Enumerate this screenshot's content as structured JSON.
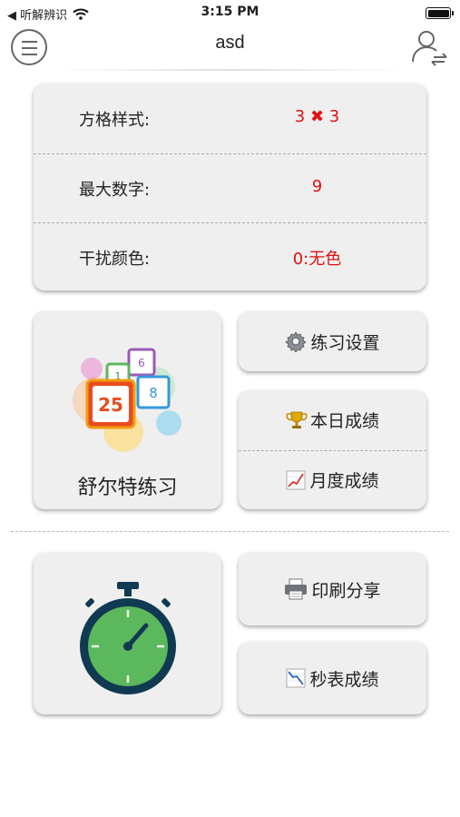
{
  "status_bar": {
    "carrier": "◀ 听解辨识",
    "time": "3:15 PM"
  },
  "nav": {
    "title": "asd"
  },
  "settings": {
    "rows": [
      {
        "label": "方格样式:",
        "value": "3 ✖ 3"
      },
      {
        "label": "最大数字:",
        "value": "9"
      },
      {
        "label": "干扰颜色:",
        "value": "0:无色"
      }
    ]
  },
  "schulte": {
    "caption": "舒尔特练习",
    "tiles": [
      "25",
      "8",
      "1",
      "6"
    ]
  },
  "buttons": {
    "practice_settings": "练习设置",
    "daily_score": "本日成绩",
    "monthly_score": "月度成绩",
    "print_share": "印刷分享",
    "stopwatch_score": "秒表成绩"
  },
  "colors": {
    "accent_red": "#e01010",
    "card_bg": "#efefef",
    "timer_green": "#5cb85c",
    "timer_navy": "#103a52"
  }
}
